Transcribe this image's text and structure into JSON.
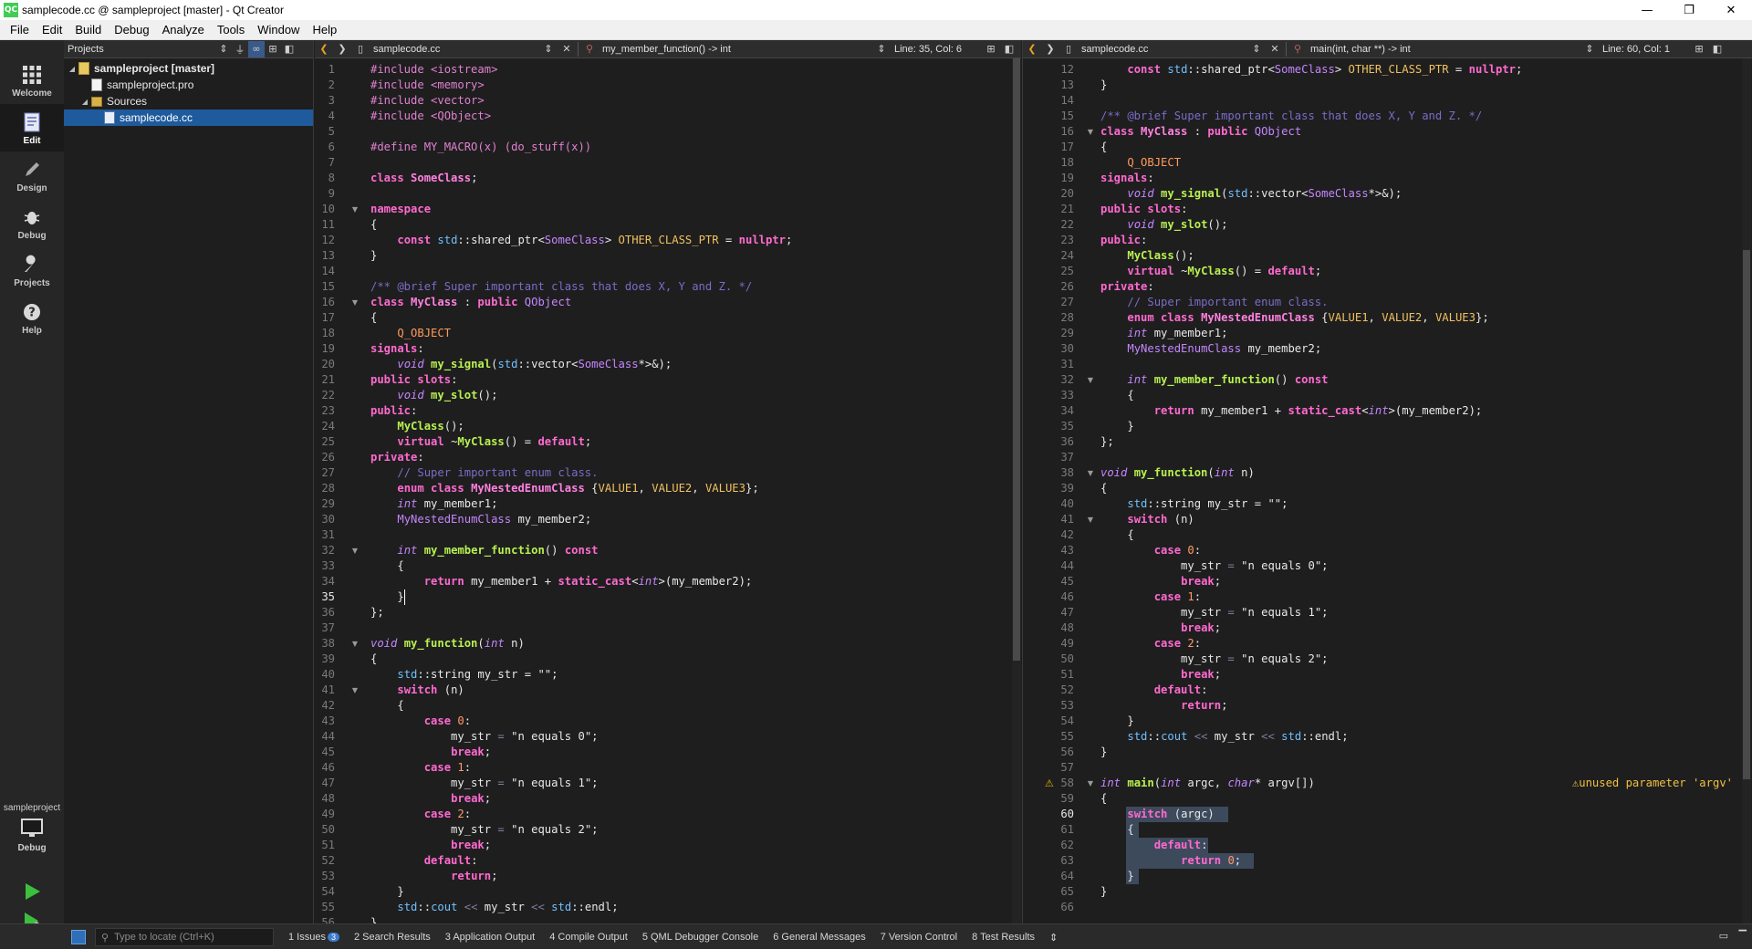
{
  "window": {
    "app_icon": "QC",
    "title": "samplecode.cc @ sampleproject [master] - Qt Creator",
    "minimize": "—",
    "maximize": "❐",
    "close": "✕"
  },
  "menu": [
    "File",
    "Edit",
    "Build",
    "Debug",
    "Analyze",
    "Tools",
    "Window",
    "Help"
  ],
  "modes": [
    {
      "label": "Welcome",
      "icon": "welcome-grid-icon"
    },
    {
      "label": "Edit",
      "icon": "edit-document-icon"
    },
    {
      "label": "Design",
      "icon": "design-pencil-icon"
    },
    {
      "label": "Debug",
      "icon": "debug-bug-icon"
    },
    {
      "label": "Projects",
      "icon": "projects-wrench-icon"
    },
    {
      "label": "Help",
      "icon": "help-question-icon"
    }
  ],
  "kit": {
    "project": "sampleproject",
    "config": "Debug"
  },
  "projects_pane": {
    "title": "Projects",
    "tree": [
      {
        "label": "sampleproject [master]",
        "level": 0,
        "kind": "proj",
        "expanded": true
      },
      {
        "label": "sampleproject.pro",
        "level": 1,
        "kind": "file"
      },
      {
        "label": "Sources",
        "level": 1,
        "kind": "folder",
        "expanded": true
      },
      {
        "label": "samplecode.cc",
        "level": 2,
        "kind": "cc",
        "selected": true
      }
    ]
  },
  "editor_left": {
    "file": "samplecode.cc",
    "symbol": "my_member_function() -> int",
    "position": "Line: 35, Col: 6"
  },
  "editor_right": {
    "file": "samplecode.cc",
    "symbol": "main(int, char **) -> int",
    "position": "Line: 60, Col: 1",
    "warning": "unused parameter 'argv'"
  },
  "code_lines": [
    [
      [
        "c-pre",
        "#include <iostream>"
      ]
    ],
    [
      [
        "c-pre",
        "#include <memory>"
      ]
    ],
    [
      [
        "c-pre",
        "#include <vector>"
      ]
    ],
    [
      [
        "c-pre",
        "#include <QObject>"
      ]
    ],
    [],
    [
      [
        "c-pre",
        "#define MY_MACRO(x) (do_stuff(x))"
      ]
    ],
    [],
    [
      [
        "c-kw",
        "class "
      ],
      [
        "c-cls",
        "SomeClass"
      ],
      [
        "c-plain",
        ";"
      ]
    ],
    [],
    [
      [
        "c-kw",
        "namespace"
      ]
    ],
    [
      [
        "c-plain",
        "{"
      ]
    ],
    [
      [
        "c-plain",
        "    "
      ],
      [
        "c-kw",
        "const "
      ],
      [
        "c-ns",
        "std"
      ],
      [
        "c-plain",
        "::shared_ptr<"
      ],
      [
        "c-type",
        "SomeClass"
      ],
      [
        "c-plain",
        "> "
      ],
      [
        "c-enumv",
        "OTHER_CLASS_PTR"
      ],
      [
        "c-plain",
        " = "
      ],
      [
        "c-kw",
        "nullptr"
      ],
      [
        "c-plain",
        ";"
      ]
    ],
    [
      [
        "c-plain",
        "}"
      ]
    ],
    [],
    [
      [
        "c-com",
        "/** @brief Super important class that does X, Y and Z. */"
      ]
    ],
    [
      [
        "c-kw",
        "class "
      ],
      [
        "c-cls",
        "MyClass"
      ],
      [
        "c-plain",
        " : "
      ],
      [
        "c-kw",
        "public "
      ],
      [
        "c-type",
        "QObject"
      ]
    ],
    [
      [
        "c-plain",
        "{"
      ]
    ],
    [
      [
        "c-plain",
        "    "
      ],
      [
        "c-mac",
        "Q_OBJECT"
      ]
    ],
    [
      [
        "c-kw",
        "signals"
      ],
      [
        "c-plain",
        ":"
      ]
    ],
    [
      [
        "c-plain",
        "    "
      ],
      [
        "c-it",
        "void "
      ],
      [
        "c-fn",
        "my_signal"
      ],
      [
        "c-plain",
        "("
      ],
      [
        "c-ns",
        "std"
      ],
      [
        "c-plain",
        "::vector<"
      ],
      [
        "c-type",
        "SomeClass"
      ],
      [
        "c-plain",
        "*>&);"
      ]
    ],
    [
      [
        "c-kw",
        "public slots"
      ],
      [
        "c-plain",
        ":"
      ]
    ],
    [
      [
        "c-plain",
        "    "
      ],
      [
        "c-it",
        "void "
      ],
      [
        "c-fn",
        "my_slot"
      ],
      [
        "c-plain",
        "();"
      ]
    ],
    [
      [
        "c-kw",
        "public"
      ],
      [
        "c-plain",
        ":"
      ]
    ],
    [
      [
        "c-plain",
        "    "
      ],
      [
        "c-fn",
        "MyClass"
      ],
      [
        "c-plain",
        "();"
      ]
    ],
    [
      [
        "c-plain",
        "    "
      ],
      [
        "c-kw",
        "virtual "
      ],
      [
        "c-plain",
        "~"
      ],
      [
        "c-fn",
        "MyClass"
      ],
      [
        "c-plain",
        "() = "
      ],
      [
        "c-kw",
        "default"
      ],
      [
        "c-plain",
        ";"
      ]
    ],
    [
      [
        "c-kw",
        "private"
      ],
      [
        "c-plain",
        ":"
      ]
    ],
    [
      [
        "c-plain",
        "    "
      ],
      [
        "c-com",
        "// Super important enum class."
      ]
    ],
    [
      [
        "c-plain",
        "    "
      ],
      [
        "c-kw",
        "enum class "
      ],
      [
        "c-cls",
        "MyNestedEnumClass"
      ],
      [
        "c-plain",
        " {"
      ],
      [
        "c-enumv",
        "VALUE1"
      ],
      [
        "c-plain",
        ", "
      ],
      [
        "c-enumv",
        "VALUE2"
      ],
      [
        "c-plain",
        ", "
      ],
      [
        "c-enumv",
        "VALUE3"
      ],
      [
        "c-plain",
        "};"
      ]
    ],
    [
      [
        "c-plain",
        "    "
      ],
      [
        "c-it",
        "int "
      ],
      [
        "c-plain",
        "my_member1;"
      ]
    ],
    [
      [
        "c-plain",
        "    "
      ],
      [
        "c-type",
        "MyNestedEnumClass"
      ],
      [
        "c-plain",
        " my_member2;"
      ]
    ],
    [],
    [
      [
        "c-plain",
        "    "
      ],
      [
        "c-it",
        "int "
      ],
      [
        "c-fn",
        "my_member_function"
      ],
      [
        "c-plain",
        "() "
      ],
      [
        "c-kw",
        "const"
      ]
    ],
    [
      [
        "c-plain",
        "    {"
      ]
    ],
    [
      [
        "c-plain",
        "        "
      ],
      [
        "c-kw",
        "return "
      ],
      [
        "c-plain",
        "my_member1 + "
      ],
      [
        "c-kw",
        "static_cast"
      ],
      [
        "c-plain",
        "<"
      ],
      [
        "c-it",
        "int"
      ],
      [
        "c-plain",
        ">(my_member2);"
      ]
    ],
    [
      [
        "c-plain",
        "    }"
      ]
    ],
    [
      [
        "c-plain",
        "};"
      ]
    ],
    [],
    [
      [
        "c-it",
        "void "
      ],
      [
        "c-fn",
        "my_function"
      ],
      [
        "c-plain",
        "("
      ],
      [
        "c-it",
        "int "
      ],
      [
        "c-plain",
        "n)"
      ]
    ],
    [
      [
        "c-plain",
        "{"
      ]
    ],
    [
      [
        "c-plain",
        "    "
      ],
      [
        "c-ns",
        "std"
      ],
      [
        "c-plain",
        "::string my_str = \"\";"
      ]
    ],
    [
      [
        "c-plain",
        "    "
      ],
      [
        "c-kw",
        "switch "
      ],
      [
        "c-plain",
        "(n)"
      ]
    ],
    [
      [
        "c-plain",
        "    {"
      ]
    ],
    [
      [
        "c-plain",
        "        "
      ],
      [
        "c-kw",
        "case "
      ],
      [
        "c-num",
        "0"
      ],
      [
        "c-plain",
        ":"
      ]
    ],
    [
      [
        "c-plain",
        "            my_str "
      ],
      [
        "c-op",
        "="
      ],
      [
        "c-str",
        " \"n equals 0\""
      ],
      [
        "c-plain",
        ";"
      ]
    ],
    [
      [
        "c-plain",
        "            "
      ],
      [
        "c-kw",
        "break"
      ],
      [
        "c-plain",
        ";"
      ]
    ],
    [
      [
        "c-plain",
        "        "
      ],
      [
        "c-kw",
        "case "
      ],
      [
        "c-num",
        "1"
      ],
      [
        "c-plain",
        ":"
      ]
    ],
    [
      [
        "c-plain",
        "            my_str "
      ],
      [
        "c-op",
        "="
      ],
      [
        "c-str",
        " \"n equals 1\""
      ],
      [
        "c-plain",
        ";"
      ]
    ],
    [
      [
        "c-plain",
        "            "
      ],
      [
        "c-kw",
        "break"
      ],
      [
        "c-plain",
        ";"
      ]
    ],
    [
      [
        "c-plain",
        "        "
      ],
      [
        "c-kw",
        "case "
      ],
      [
        "c-num",
        "2"
      ],
      [
        "c-plain",
        ":"
      ]
    ],
    [
      [
        "c-plain",
        "            my_str "
      ],
      [
        "c-op",
        "="
      ],
      [
        "c-str",
        " \"n equals 2\""
      ],
      [
        "c-plain",
        ";"
      ]
    ],
    [
      [
        "c-plain",
        "            "
      ],
      [
        "c-kw",
        "break"
      ],
      [
        "c-plain",
        ";"
      ]
    ],
    [
      [
        "c-plain",
        "        "
      ],
      [
        "c-kw",
        "default"
      ],
      [
        "c-plain",
        ":"
      ]
    ],
    [
      [
        "c-plain",
        "            "
      ],
      [
        "c-kw",
        "return"
      ],
      [
        "c-plain",
        ";"
      ]
    ],
    [
      [
        "c-plain",
        "    }"
      ]
    ],
    [
      [
        "c-plain",
        "    "
      ],
      [
        "c-ns",
        "std"
      ],
      [
        "c-plain",
        "::"
      ],
      [
        "c-ns",
        "cout"
      ],
      [
        "c-op",
        " << "
      ],
      [
        "c-plain",
        "my_str"
      ],
      [
        "c-op",
        " << "
      ],
      [
        "c-ns",
        "std"
      ],
      [
        "c-plain",
        "::endl;"
      ]
    ],
    [
      [
        "c-plain",
        "}"
      ]
    ],
    [],
    [
      [
        "c-it",
        "int "
      ],
      [
        "c-fn",
        "main"
      ],
      [
        "c-plain",
        "("
      ],
      [
        "c-it",
        "int "
      ],
      [
        "c-plain",
        "argc, "
      ],
      [
        "c-it",
        "char"
      ],
      [
        "c-plain",
        "* argv[])"
      ]
    ],
    [
      [
        "c-plain",
        "{"
      ]
    ],
    [
      [
        "c-plain",
        "    "
      ],
      [
        "c-kw",
        "switch "
      ],
      [
        "c-plain",
        "(argc)"
      ]
    ],
    [
      [
        "c-plain",
        "    {"
      ]
    ],
    [
      [
        "c-plain",
        "        "
      ],
      [
        "c-kw",
        "default"
      ],
      [
        "c-plain",
        ":"
      ]
    ],
    [
      [
        "c-plain",
        "            "
      ],
      [
        "c-kw",
        "return "
      ],
      [
        "c-num",
        "0"
      ],
      [
        "c-plain",
        ";"
      ]
    ],
    [
      [
        "c-plain",
        "    }"
      ]
    ],
    [
      [
        "c-plain",
        "}"
      ]
    ],
    []
  ],
  "fold_lines": [
    10,
    16,
    32,
    38,
    41,
    58
  ],
  "bottom": {
    "locator_placeholder": "Type to locate (Ctrl+K)",
    "tabs": [
      {
        "label": "1  Issues",
        "badge": "3"
      },
      {
        "label": "2  Search Results"
      },
      {
        "label": "3  Application Output"
      },
      {
        "label": "4  Compile Output"
      },
      {
        "label": "5  QML Debugger Console"
      },
      {
        "label": "6  General Messages"
      },
      {
        "label": "7  Version Control"
      },
      {
        "label": "8  Test Results"
      }
    ]
  }
}
